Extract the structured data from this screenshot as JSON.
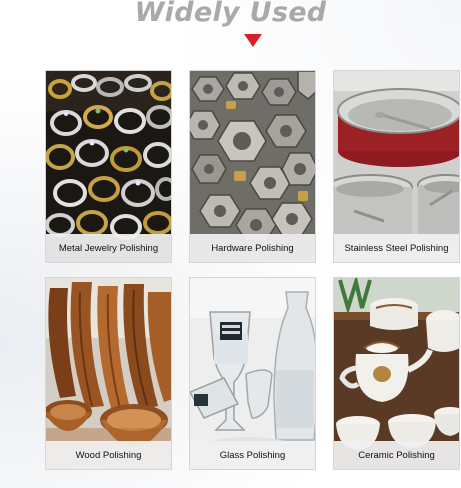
{
  "header": {
    "title": "Widely Used",
    "title_color": "#a9a9a9",
    "arrow_color": "#d61f26",
    "arrow_icon": "triangle-down-icon"
  },
  "cards": [
    {
      "label": "Metal Jewelry Polishing",
      "image": "rings-photo"
    },
    {
      "label": "Hardware Polishing",
      "image": "nuts-bolts-photo"
    },
    {
      "label": "Stainless Steel Polishing",
      "image": "steel-pots-photo"
    },
    {
      "label": "Wood Polishing",
      "image": "wooden-bowls-photo"
    },
    {
      "label": "Glass Polishing",
      "image": "glassware-photo"
    },
    {
      "label": "Ceramic Polishing",
      "image": "ceramic-teaset-photo"
    }
  ]
}
